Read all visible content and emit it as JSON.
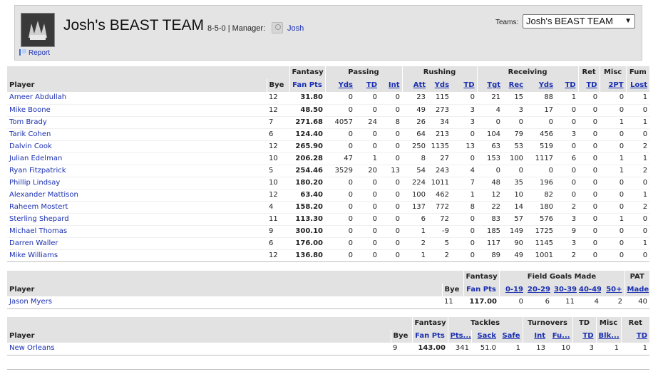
{
  "header": {
    "team_name": "Josh's BEAST TEAM",
    "record_manager": "8-5-0 | Manager:",
    "manager_name": "Josh",
    "report_label": "Report",
    "teams_label": "Teams:",
    "teams_selected": "Josh's BEAST TEAM"
  },
  "players_table": {
    "groups": [
      "Fantasy",
      "Passing",
      "Rushing",
      "Receiving",
      "Ret",
      "Misc",
      "Fum"
    ],
    "columns": [
      "Player",
      "Bye",
      "Fan Pts",
      "Yds",
      "TD",
      "Int",
      "Att",
      "Yds",
      "TD",
      "Tgt",
      "Rec",
      "Yds",
      "TD",
      "TD",
      "2PT",
      "Lost"
    ],
    "rows": [
      [
        "Ameer Abdullah",
        "12",
        "31.80",
        "0",
        "0",
        "0",
        "23",
        "115",
        "0",
        "21",
        "15",
        "88",
        "1",
        "0",
        "0",
        "1"
      ],
      [
        "Mike Boone",
        "12",
        "48.50",
        "0",
        "0",
        "0",
        "49",
        "273",
        "3",
        "4",
        "3",
        "17",
        "0",
        "0",
        "0",
        "0"
      ],
      [
        "Tom Brady",
        "7",
        "271.68",
        "4057",
        "24",
        "8",
        "26",
        "34",
        "3",
        "0",
        "0",
        "0",
        "0",
        "0",
        "1",
        "1"
      ],
      [
        "Tarik Cohen",
        "6",
        "124.40",
        "0",
        "0",
        "0",
        "64",
        "213",
        "0",
        "104",
        "79",
        "456",
        "3",
        "0",
        "0",
        "0"
      ],
      [
        "Dalvin Cook",
        "12",
        "265.90",
        "0",
        "0",
        "0",
        "250",
        "1135",
        "13",
        "63",
        "53",
        "519",
        "0",
        "0",
        "0",
        "2"
      ],
      [
        "Julian Edelman",
        "10",
        "206.28",
        "47",
        "1",
        "0",
        "8",
        "27",
        "0",
        "153",
        "100",
        "1117",
        "6",
        "0",
        "1",
        "1"
      ],
      [
        "Ryan Fitzpatrick",
        "5",
        "254.46",
        "3529",
        "20",
        "13",
        "54",
        "243",
        "4",
        "0",
        "0",
        "0",
        "0",
        "0",
        "1",
        "2"
      ],
      [
        "Phillip Lindsay",
        "10",
        "180.20",
        "0",
        "0",
        "0",
        "224",
        "1011",
        "7",
        "48",
        "35",
        "196",
        "0",
        "0",
        "0",
        "0"
      ],
      [
        "Alexander Mattison",
        "12",
        "63.40",
        "0",
        "0",
        "0",
        "100",
        "462",
        "1",
        "12",
        "10",
        "82",
        "0",
        "0",
        "0",
        "1"
      ],
      [
        "Raheem Mostert",
        "4",
        "158.20",
        "0",
        "0",
        "0",
        "137",
        "772",
        "8",
        "22",
        "14",
        "180",
        "2",
        "0",
        "0",
        "2"
      ],
      [
        "Sterling Shepard",
        "11",
        "113.30",
        "0",
        "0",
        "0",
        "6",
        "72",
        "0",
        "83",
        "57",
        "576",
        "3",
        "0",
        "1",
        "0"
      ],
      [
        "Michael Thomas",
        "9",
        "300.10",
        "0",
        "0",
        "0",
        "1",
        "-9",
        "0",
        "185",
        "149",
        "1725",
        "9",
        "0",
        "0",
        "0"
      ],
      [
        "Darren Waller",
        "6",
        "176.00",
        "0",
        "0",
        "0",
        "2",
        "5",
        "0",
        "117",
        "90",
        "1145",
        "3",
        "0",
        "0",
        "1"
      ],
      [
        "Mike Williams",
        "12",
        "136.80",
        "0",
        "0",
        "0",
        "1",
        "2",
        "0",
        "89",
        "49",
        "1001",
        "2",
        "0",
        "0",
        "0"
      ]
    ]
  },
  "kicker_table": {
    "groups": [
      "Fantasy",
      "Field Goals Made",
      "PAT"
    ],
    "columns": [
      "Player",
      "Bye",
      "Fan Pts",
      "0-19",
      "20-29",
      "30-39",
      "40-49",
      "50+",
      "Made"
    ],
    "rows": [
      [
        "Jason Myers",
        "11",
        "117.00",
        "0",
        "6",
        "11",
        "4",
        "2",
        "40"
      ]
    ]
  },
  "defense_table": {
    "groups": [
      "Fantasy",
      "Tackles",
      "Turnovers",
      "TD",
      "Misc",
      "Ret"
    ],
    "columns": [
      "Player",
      "Bye",
      "Fan Pts",
      "Pts...",
      "Sack",
      "Safe",
      "Int",
      "Fu...",
      "TD",
      "Blk...",
      "TD"
    ],
    "rows": [
      [
        "New Orleans",
        "9",
        "143.00",
        "341",
        "51.0",
        "1",
        "13",
        "10",
        "3",
        "1",
        "1"
      ]
    ]
  }
}
